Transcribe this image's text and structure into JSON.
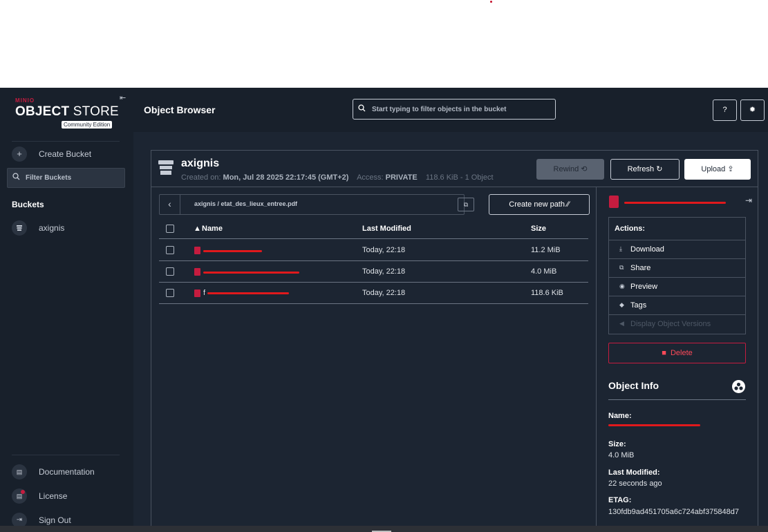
{
  "sidebar": {
    "logo_brand": "MINIO",
    "logo_bold": "OBJECT",
    "logo_rest": " STORE",
    "logo_edition": "Community Edition",
    "create_bucket": "Create Bucket",
    "filter_placeholder": "Filter Buckets",
    "buckets_title": "Buckets",
    "buckets": [
      {
        "name": "axignis"
      }
    ],
    "links": {
      "documentation": "Documentation",
      "license": "License",
      "sign_out": "Sign Out"
    }
  },
  "header": {
    "title": "Object Browser",
    "search_placeholder": "Start typing to filter objects in the bucket"
  },
  "bucket": {
    "name": "axignis",
    "created_label": "Created on:",
    "created_value": "Mon, Jul 28 2025 22:17:45 (GMT+2)",
    "access_label": "Access:",
    "access_value": "PRIVATE",
    "summary": "118.6 KiB - 1 Object",
    "rewind": "Rewind",
    "refresh": "Refresh",
    "upload": "Upload"
  },
  "path": {
    "value": "axignis / etat_des_lieux_entree.pdf",
    "create_new_path": "Create new path"
  },
  "table": {
    "headers": {
      "name": "Name",
      "modified": "Last Modified",
      "size": "Size"
    },
    "rows": [
      {
        "name_visible": "",
        "modified": "Today, 22:18",
        "size": "11.2 MiB"
      },
      {
        "name_visible": "",
        "modified": "Today, 22:18",
        "size": "4.0 MiB"
      },
      {
        "name_visible": "f",
        "modified": "Today, 22:18",
        "size": "118.6 KiB"
      }
    ]
  },
  "details": {
    "actions_title": "Actions:",
    "actions": {
      "download": "Download",
      "share": "Share",
      "preview": "Preview",
      "tags": "Tags",
      "versions": "Display Object Versions"
    },
    "delete": "Delete",
    "info_title": "Object Info",
    "name_label": "Name:",
    "size_label": "Size:",
    "size_value": "4.0 MiB",
    "modified_label": "Last Modified:",
    "modified_value": "22 seconds ago",
    "etag_label": "ETAG:",
    "etag_value": "130fdb9ad451705a6c724abf375848d7"
  },
  "colors": {
    "accent": "#c51c3f",
    "redaction": "#e0191c",
    "bg": "#1c2532",
    "sidebar": "#18202b"
  }
}
